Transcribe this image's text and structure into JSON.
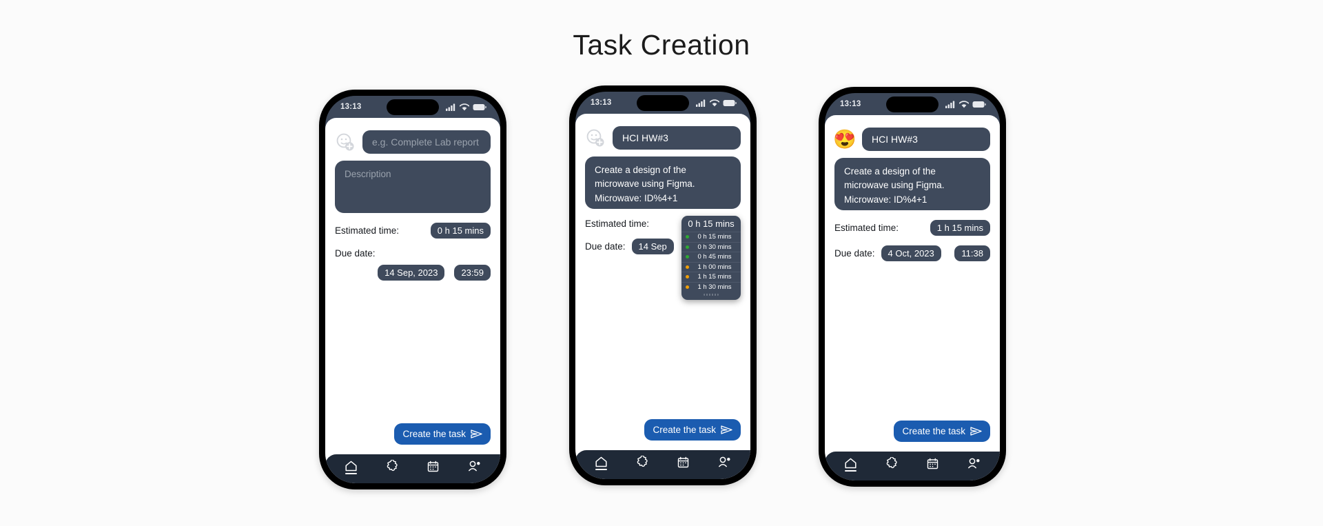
{
  "page": {
    "title": "Task Creation",
    "background_color": "#fbfbfb"
  },
  "colors": {
    "phone_frame": "#000000",
    "phone_bezel": "#3c4759",
    "field_bg": "#3f4a5c",
    "placeholder_text": "#9aa2ad",
    "accent_button": "#1b5cb0",
    "nav_bar": "#1f2937",
    "dot_green": "#2fa832",
    "dot_orange": "#f0a008"
  },
  "status_bar": {
    "time": "13:13",
    "icons": [
      "signal-icon",
      "wifi-icon",
      "battery-icon"
    ]
  },
  "nav_bar": {
    "items": [
      {
        "name": "home",
        "icon": "home-icon",
        "active": true
      },
      {
        "name": "puzzle",
        "icon": "puzzle-icon",
        "active": false
      },
      {
        "name": "calendar",
        "icon": "calendar-icon",
        "active": false
      },
      {
        "name": "profile",
        "icon": "person-icon",
        "active": false
      }
    ]
  },
  "labels": {
    "estimated_time": "Estimated time:",
    "due_date": "Due date:",
    "create_button": "Create the task",
    "send_icon": "send-icon",
    "add_emoji_icon": "add-emoji-icon"
  },
  "screens": [
    {
      "id": "empty-form",
      "emoji": "",
      "emoji_icon": "add-emoji-icon",
      "title_value": "",
      "title_placeholder": "e.g. Complete Lab report",
      "description_value": "",
      "description_placeholder": "Description",
      "estimated_time": "0 h  15 mins",
      "date_value": "14 Sep, 2023",
      "time_value": "23:59",
      "dropdown_open": false
    },
    {
      "id": "time-picker-open",
      "emoji": "",
      "emoji_icon": "add-emoji-icon",
      "title_value": "HCI HW#3",
      "title_placeholder": "e.g. Complete Lab report",
      "description_value": "Create a design of the microwave using Figma. Microwave: ID%4+1",
      "description_placeholder": "Description",
      "estimated_time": "0 h  15 mins",
      "date_value": "14 Sep",
      "time_value": "",
      "dropdown_open": true,
      "dropdown": {
        "selected": "0 h  15 mins",
        "options": [
          {
            "label": "0 h  15 mins",
            "color": "#2fa832"
          },
          {
            "label": "0 h  30 mins",
            "color": "#2fa832"
          },
          {
            "label": "0 h  45 mins",
            "color": "#2fa832"
          },
          {
            "label": "1 h  00 mins",
            "color": "#f0a008"
          },
          {
            "label": "1 h  15 mins",
            "color": "#f0a008"
          },
          {
            "label": "1 h  30 mins",
            "color": "#f0a008"
          }
        ]
      }
    },
    {
      "id": "completed-form",
      "emoji": "😍",
      "emoji_icon": "heart-eyes-emoji",
      "title_value": "HCI HW#3",
      "title_placeholder": "e.g. Complete Lab report",
      "description_value": "Create a design of the microwave using Figma. Microwave: ID%4+1",
      "description_placeholder": "Description",
      "estimated_time": "1 h  15 mins",
      "date_value": "4 Oct, 2023",
      "time_value": "11:38",
      "dropdown_open": false
    }
  ]
}
